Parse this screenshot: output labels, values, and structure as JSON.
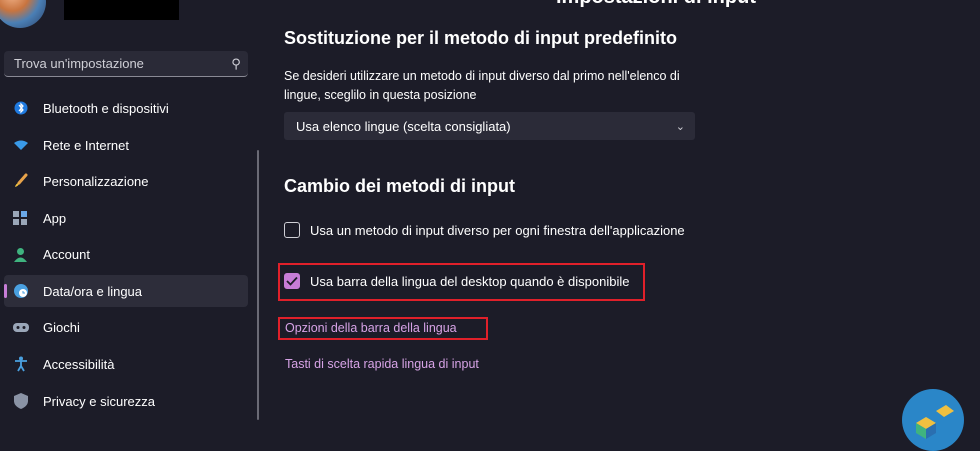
{
  "header": {
    "title_fragment": "impostazioni di input"
  },
  "search": {
    "placeholder": "Trova un'impostazione"
  },
  "nav": {
    "items": [
      {
        "label": "Bluetooth e dispositivi",
        "icon": "bluetooth-icon"
      },
      {
        "label": "Rete e Internet",
        "icon": "wifi-icon"
      },
      {
        "label": "Personalizzazione",
        "icon": "brush-icon"
      },
      {
        "label": "App",
        "icon": "apps-icon"
      },
      {
        "label": "Account",
        "icon": "account-icon"
      },
      {
        "label": "Data/ora e lingua",
        "icon": "globe-clock-icon",
        "active": true
      },
      {
        "label": "Giochi",
        "icon": "gamepad-icon"
      },
      {
        "label": "Accessibilità",
        "icon": "accessibility-icon"
      },
      {
        "label": "Privacy e sicurezza",
        "icon": "shield-icon"
      }
    ]
  },
  "main": {
    "override": {
      "title": "Sostituzione per il metodo di input predefinito",
      "description": "Se desideri utilizzare un metodo di input diverso dal primo nell'elenco di lingue, sceglilo in questa posizione",
      "select_value": "Usa elenco lingue (scelta consigliata)"
    },
    "switching": {
      "title": "Cambio dei metodi di input",
      "checkbox1_label": "Usa un metodo di input diverso per ogni finestra dell'applicazione",
      "checkbox1_checked": false,
      "checkbox2_label": "Usa barra della lingua del desktop quando è disponibile",
      "checkbox2_checked": true,
      "link1": "Opzioni della barra della lingua",
      "link2": "Tasti di scelta rapida lingua di input"
    }
  },
  "colors": {
    "background": "#1c1c28",
    "accent": "#c77dd7",
    "link": "#d7a3e6",
    "highlight": "#e0202a"
  }
}
